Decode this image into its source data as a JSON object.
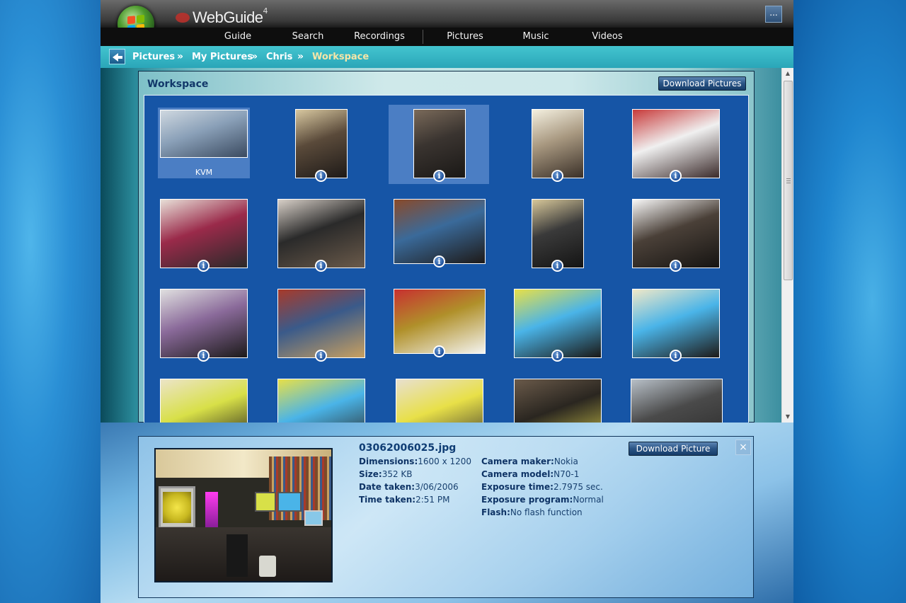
{
  "header": {
    "logo_text": "WebGuide",
    "logo_sup": "4",
    "menu_button": "...",
    "nav": [
      "Guide",
      "Search",
      "Recordings",
      "Pictures",
      "Music",
      "Videos"
    ]
  },
  "breadcrumb": {
    "items": [
      "Pictures",
      "My Pictures",
      "Chris"
    ],
    "current": "Workspace",
    "separator": "»"
  },
  "gallery": {
    "title": "Workspace",
    "download_all_label": "Download Pictures",
    "folder_label": "KVM",
    "info_glyph": "i"
  },
  "detail": {
    "filename": "03062006025.jpg",
    "download_label": "Download Picture",
    "close_glyph": "×",
    "left": [
      {
        "label": "Dimensions:",
        "value": "1600 x 1200"
      },
      {
        "label": "Size:",
        "value": "352 KB"
      },
      {
        "label": "Date taken:",
        "value": "3/06/2006"
      },
      {
        "label": "Time taken:",
        "value": "2:51 PM"
      }
    ],
    "right": [
      {
        "label": "Camera maker:",
        "value": "Nokia"
      },
      {
        "label": "Camera model:",
        "value": "N70-1"
      },
      {
        "label": "Exposure time:",
        "value": "2.7975 sec."
      },
      {
        "label": "Exposure program:",
        "value": "Normal"
      },
      {
        "label": "Flash:",
        "value": "No flash function"
      }
    ]
  },
  "colors": {
    "accent": "#1655a6",
    "breadcrumb_bar": "#2aa6b8",
    "current_crumb": "#f5e6a8",
    "title_text": "#12386a"
  },
  "icons": {
    "back": "back-arrow-icon",
    "info": "info-icon",
    "close": "close-icon",
    "start_orb": "windows-orb-icon"
  }
}
